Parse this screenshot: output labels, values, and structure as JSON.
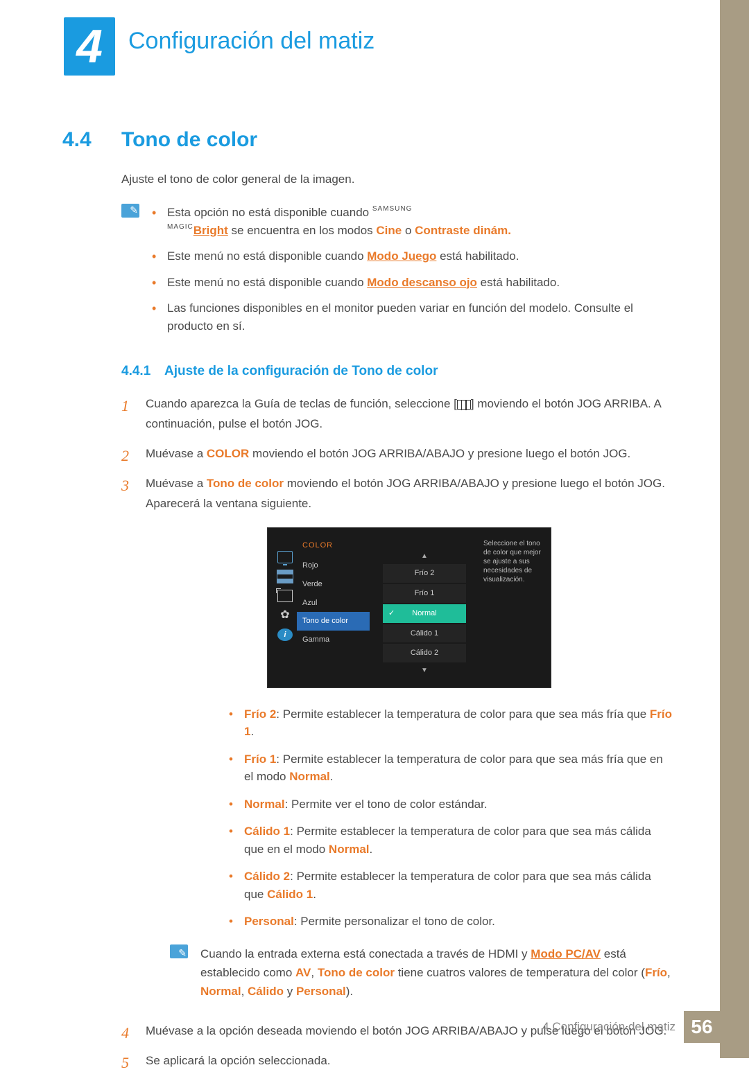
{
  "chapter": {
    "number": "4",
    "title": "Configuración del matiz"
  },
  "section": {
    "number": "4.4",
    "title": "Tono de color"
  },
  "intro": "Ajuste el tono de color general de la imagen.",
  "notes1": {
    "n1_pre": "Esta opción no está disponible cuando ",
    "n1_magic_s": "SAMSUNG",
    "n1_magic_m": "MAGIC",
    "n1_bright": "Bright",
    "n1_mid": " se encuentra en los modos ",
    "n1_cine": "Cine",
    "n1_or": " o ",
    "n1_contr": "Contraste dinám.",
    "n2_pre": "Este menú no está disponible cuando ",
    "n2_link": "Modo Juego",
    "n2_post": " está habilitado.",
    "n3_pre": "Este menú no está disponible cuando ",
    "n3_link": "Modo descanso ojo",
    "n3_post": " está habilitado.",
    "n4": "Las funciones disponibles en el monitor pueden variar en función del modelo. Consulte el producto en sí."
  },
  "subsection": {
    "number": "4.4.1",
    "title": "Ajuste de la configuración de Tono de color"
  },
  "steps": {
    "s1a": "Cuando aparezca la Guía de teclas de función, seleccione [",
    "s1b": "] moviendo el botón JOG ARRIBA. A continuación, pulse el botón JOG.",
    "s2a": "Muévase a ",
    "s2_color": "COLOR",
    "s2b": " moviendo el botón JOG ARRIBA/ABAJO y presione luego el botón JOG.",
    "s3a": "Muévase a ",
    "s3_tono": "Tono de color",
    "s3b": " moviendo el botón JOG ARRIBA/ABAJO y presione luego el botón JOG. Aparecerá la ventana siguiente.",
    "s4": "Muévase a la opción deseada moviendo el botón JOG ARRIBA/ABAJO y pulse luego el botón JOG.",
    "s5": "Se aplicará la opción seleccionada."
  },
  "osd": {
    "header": "COLOR",
    "left": [
      "Rojo",
      "Verde",
      "Azul",
      "Tono de color",
      "Gamma"
    ],
    "selectedLeft": 3,
    "options": [
      "Frío 2",
      "Frío 1",
      "Normal",
      "Cálido 1",
      "Cálido 2"
    ],
    "selectedOpt": 2,
    "help": "Seleccione el tono de color que mejor se ajuste a sus necesidades de visualización."
  },
  "descriptions": {
    "d1_name": "Frío 2",
    "d1_text": ": Permite establecer la temperatura de color para que sea más fría que ",
    "d1_ref": "Frío 1",
    "d2_name": "Frío 1",
    "d2_text": ": Permite establecer la temperatura de color para que sea más fría que en el modo ",
    "d2_ref": "Normal",
    "d3_name": "Normal",
    "d3_text": ": Permite ver el tono de color estándar.",
    "d4_name": "Cálido 1",
    "d4_text": ": Permite establecer la temperatura de color para que sea más cálida que en el modo ",
    "d4_ref": "Normal",
    "d5_name": "Cálido 2",
    "d5_text": ": Permite establecer la temperatura de color para que sea más cálida que ",
    "d5_ref": "Cálido 1",
    "d6_name": "Personal",
    "d6_text": ": Permite personalizar el tono de color."
  },
  "note2": {
    "p1": "Cuando la entrada externa está conectada a través de HDMI y ",
    "link": "Modo PC/AV",
    "p2": " está establecido como ",
    "av": "AV",
    "p3": ", ",
    "tono": "Tono de color",
    "p4": " tiene cuatros valores de temperatura del color (",
    "frio": "Frío",
    "c1": ", ",
    "normal": "Normal",
    "c2": ", ",
    "calido": "Cálido",
    "p5": " y ",
    "personal": "Personal",
    "p6": ")."
  },
  "footer": {
    "text": "4 Configuración del matiz",
    "page": "56"
  }
}
